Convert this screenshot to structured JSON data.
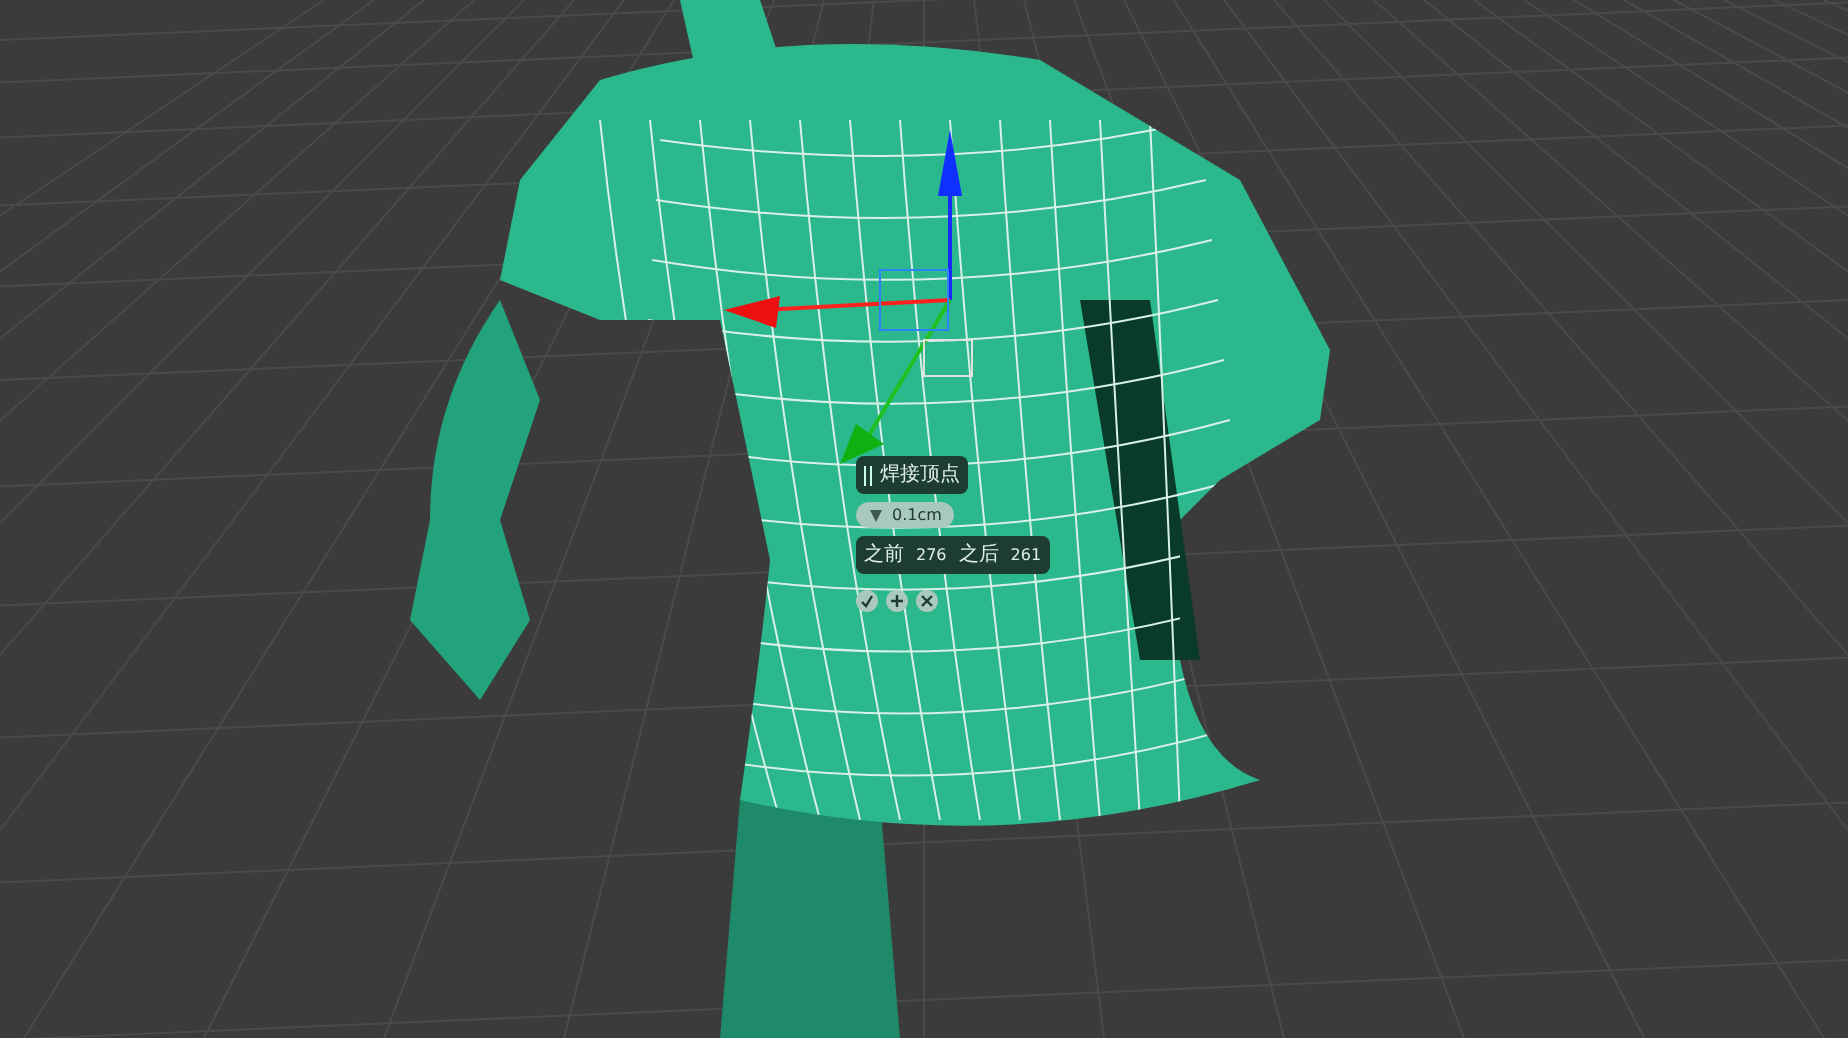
{
  "caddy": {
    "title": "焊接顶点",
    "threshold": "0.1cm",
    "before_label": "之前",
    "before": "276",
    "after_label": "之后",
    "after": "261"
  }
}
